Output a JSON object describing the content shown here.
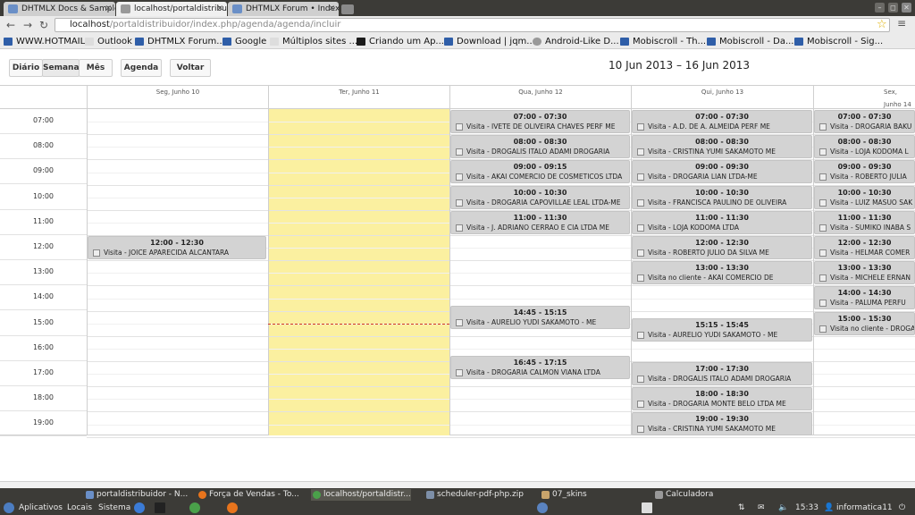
{
  "browser": {
    "tabs": [
      {
        "title": "DHTMLX Docs & Samples",
        "active": false
      },
      {
        "title": "localhost/portaldistribuid",
        "active": true
      },
      {
        "title": "DHTMLX Forum • Index pa",
        "active": false
      }
    ],
    "url_host": "localhost",
    "url_path": "/portaldistribuidor/index.php/agenda/agenda/incluir",
    "bookmarks": [
      "WWW.HOTMAIL",
      "Outlook",
      "DHTMLX Forum...",
      "Google",
      "Múltiplos sites ...",
      "Criando um Ap...",
      "Download | jqm...",
      "Android-Like D...",
      "Mobiscroll - Th...",
      "Mobiscroll - Da...",
      "Mobiscroll - Sig..."
    ]
  },
  "scheduler": {
    "buttons": {
      "day": "Diário",
      "week": "Semana",
      "month": "Mês",
      "agenda": "Agenda",
      "back": "Voltar"
    },
    "date_range": "10 Jun 2013 – 16 Jun 2013",
    "days": [
      "Seg, Junho 10",
      "Ter, Junho 11",
      "Qua, Junho 12",
      "Qui, Junho 13",
      "Sex, Junho 14"
    ],
    "hours": [
      "07:00",
      "08:00",
      "09:00",
      "10:00",
      "11:00",
      "12:00",
      "13:00",
      "14:00",
      "15:00",
      "16:00",
      "17:00",
      "18:00",
      "19:00"
    ],
    "events": [
      {
        "day": 0,
        "start": "12:00",
        "time": "12:00 - 12:30",
        "text": "Visita - JOICE APARECIDA ALCANTARA"
      },
      {
        "day": 2,
        "start": "07:00",
        "time": "07:00 - 07:30",
        "text": "Visita - IVETE DE OLIVEIRA CHAVES PERF ME"
      },
      {
        "day": 2,
        "start": "08:00",
        "time": "08:00 - 08:30",
        "text": "Visita - DROGALIS ITALO ADAMI DROGARIA"
      },
      {
        "day": 2,
        "start": "09:00",
        "time": "09:00 - 09:15",
        "text": "Visita - AKAI COMERCIO DE COSMETICOS LTDA"
      },
      {
        "day": 2,
        "start": "10:00",
        "time": "10:00 - 10:30",
        "text": "Visita - DROGARIA CAPOVILLAE LEAL LTDA-ME"
      },
      {
        "day": 2,
        "start": "11:00",
        "time": "11:00 - 11:30",
        "text": "Visita - J. ADRIANO CERRAO E CIA LTDA ME"
      },
      {
        "day": 2,
        "start": "14:45",
        "time": "14:45 - 15:15",
        "text": "Visita - AURELIO YUDI SAKAMOTO - ME"
      },
      {
        "day": 2,
        "start": "16:45",
        "time": "16:45 - 17:15",
        "text": "Visita - DROGARIA CALMON VIANA LTDA"
      },
      {
        "day": 3,
        "start": "07:00",
        "time": "07:00 - 07:30",
        "text": "Visita - A.D. DE A. ALMEIDA PERF ME"
      },
      {
        "day": 3,
        "start": "08:00",
        "time": "08:00 - 08:30",
        "text": "Visita - CRISTINA YUMI SAKAMOTO ME"
      },
      {
        "day": 3,
        "start": "09:00",
        "time": "09:00 - 09:30",
        "text": "Visita - DROGARIA LIAN LTDA-ME"
      },
      {
        "day": 3,
        "start": "10:00",
        "time": "10:00 - 10:30",
        "text": "Visita - FRANCISCA PAULINO DE OLIVEIRA"
      },
      {
        "day": 3,
        "start": "11:00",
        "time": "11:00 - 11:30",
        "text": "Visita - LOJA KODOMA LTDA"
      },
      {
        "day": 3,
        "start": "12:00",
        "time": "12:00 - 12:30",
        "text": "Visita - ROBERTO JULIO DA SILVA ME"
      },
      {
        "day": 3,
        "start": "13:00",
        "time": "13:00 - 13:30",
        "text": "Visita no cliente - AKAI COMERCIO DE"
      },
      {
        "day": 3,
        "start": "15:15",
        "time": "15:15 - 15:45",
        "text": "Visita - AURELIO YUDI SAKAMOTO - ME"
      },
      {
        "day": 3,
        "start": "17:00",
        "time": "17:00 - 17:30",
        "text": "Visita - DROGALIS ITALO ADAMI DROGARIA"
      },
      {
        "day": 3,
        "start": "18:00",
        "time": "18:00 - 18:30",
        "text": "Visita - DROGARIA MONTE BELO LTDA ME"
      },
      {
        "day": 3,
        "start": "19:00",
        "time": "19:00 - 19:30",
        "text": "Visita - CRISTINA YUMI SAKAMOTO ME"
      },
      {
        "day": 4,
        "start": "07:00",
        "time": "07:00 - 07:30",
        "text": "Visita - DROGARIA BAKU"
      },
      {
        "day": 4,
        "start": "08:00",
        "time": "08:00 - 08:30",
        "text": "Visita - LOJA KODOMA L"
      },
      {
        "day": 4,
        "start": "09:00",
        "time": "09:00 - 09:30",
        "text": "Visita - ROBERTO JULIA"
      },
      {
        "day": 4,
        "start": "10:00",
        "time": "10:00 - 10:30",
        "text": "Visita - LUIZ MASUO SAK"
      },
      {
        "day": 4,
        "start": "11:00",
        "time": "11:00 - 11:30",
        "text": "Visita - SUMIKO INABA S"
      },
      {
        "day": 4,
        "start": "12:00",
        "time": "12:00 - 12:30",
        "text": "Visita - HELMAR COMER"
      },
      {
        "day": 4,
        "start": "13:00",
        "time": "13:00 - 13:30",
        "text": "Visita - MICHELE ERNAN"
      },
      {
        "day": 4,
        "start": "14:00",
        "time": "14:00 - 14:30",
        "text": "Visita - PALUMA PERFU"
      },
      {
        "day": 4,
        "start": "15:00",
        "time": "15:00 - 15:30",
        "text": "Visita no cliente - DROGA"
      }
    ]
  },
  "taskbar": [
    {
      "label": "portaldistribuidor - N..."
    },
    {
      "label": "Força de Vendas - To..."
    },
    {
      "label": "localhost/portaldistr..."
    },
    {
      "label": "scheduler-pdf-php.zip"
    },
    {
      "label": "07_skins"
    },
    {
      "label": "Calculadora"
    }
  ],
  "panel": {
    "apps": "Aplicativos",
    "places": "Locais",
    "system": "Sistema",
    "time": "15:33",
    "user": "informatica11"
  }
}
